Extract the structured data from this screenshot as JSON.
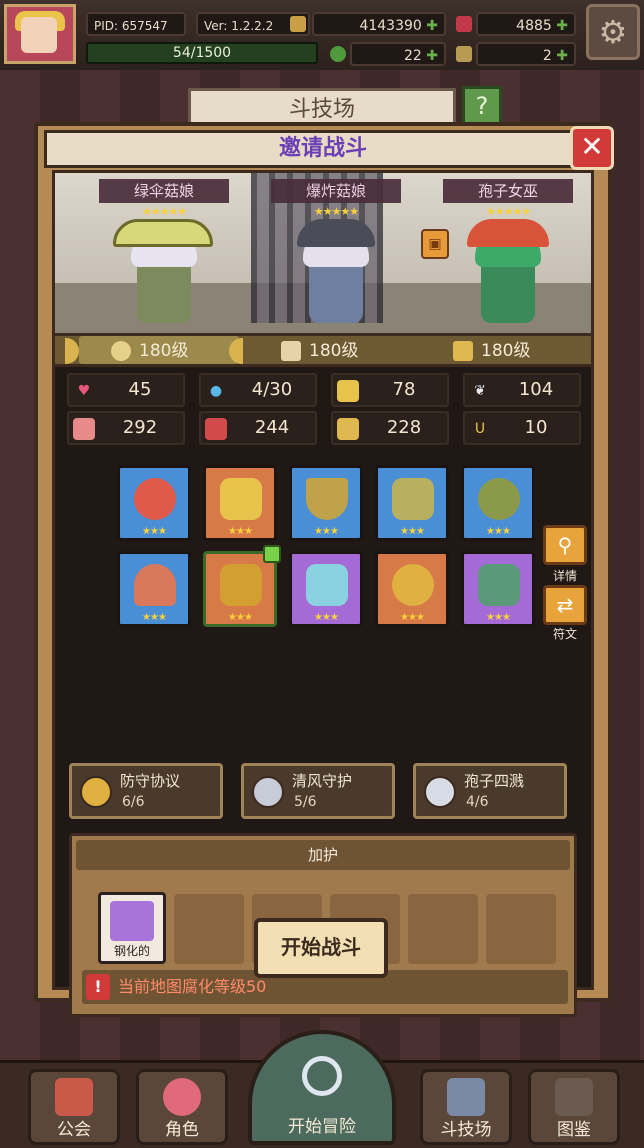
{
  "hud": {
    "pid": "PID: 657547",
    "version": "Ver: 1.2.2.2",
    "gold": "4143390",
    "gems": "4885",
    "xp": "54/1500",
    "clover": "22",
    "keys": "2"
  },
  "background": {
    "arena_sign": "斗技场"
  },
  "dialog": {
    "title": "邀请战斗",
    "heroes": [
      {
        "name": "绿伞菇娘",
        "stars": "★★★★★"
      },
      {
        "name": "爆炸菇娘",
        "stars": "★★★★★"
      },
      {
        "name": "孢子女巫",
        "stars": "★★★★★"
      }
    ],
    "levels": [
      "180级",
      "180级",
      "180级"
    ],
    "stats": [
      "45",
      "4/30",
      "78",
      "104",
      "292",
      "244",
      "228",
      "10"
    ],
    "equip_stars": "★★★",
    "side_buttons": {
      "detail": "详情",
      "rune": "符文"
    },
    "sets": [
      {
        "name": "防守协议",
        "count": "6/6"
      },
      {
        "name": "清风守护",
        "count": "5/6"
      },
      {
        "name": "孢子四溅",
        "count": "4/6"
      }
    ],
    "blessing": {
      "title": "加护",
      "slot_label": "钢化的",
      "warning": "当前地图腐化等级50"
    },
    "start_button": "开始战斗"
  },
  "nav": [
    "公会",
    "角色",
    "开始冒险",
    "斗技场",
    "图鉴"
  ],
  "colors": {
    "title_purple": "#6c3fb5",
    "close_red": "#d23a3a",
    "star_gold": "#f7d13a"
  }
}
